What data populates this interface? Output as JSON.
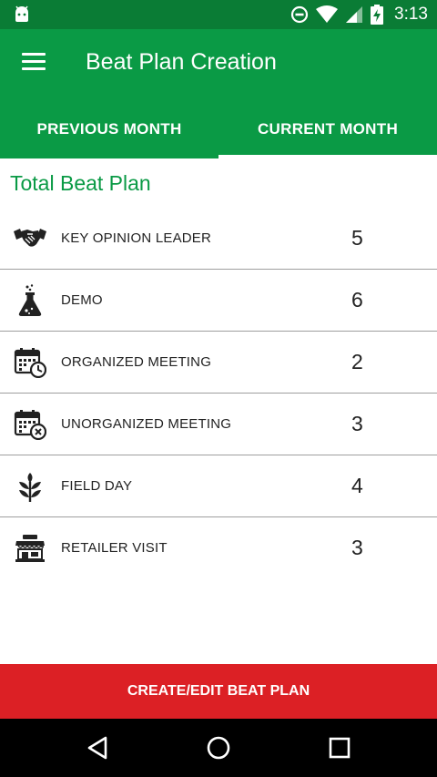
{
  "status_bar": {
    "time": "3:13",
    "icons": [
      "android-icon",
      "dnd-icon",
      "wifi-icon",
      "signal-icon",
      "battery-charging-icon"
    ]
  },
  "app_bar": {
    "menu_icon": "hamburger-menu-icon",
    "title": "Beat Plan Creation"
  },
  "tabs": [
    {
      "label": "PREVIOUS MONTH",
      "selected": false
    },
    {
      "label": "CURRENT MONTH",
      "selected": true
    }
  ],
  "section_title": "Total Beat Plan",
  "items": [
    {
      "label": "KEY OPINION LEADER",
      "count": "5",
      "icon": "handshake-icon"
    },
    {
      "label": "DEMO",
      "count": "6",
      "icon": "flask-icon"
    },
    {
      "label": "ORGANIZED MEETING",
      "count": "2",
      "icon": "calendar-clock-icon"
    },
    {
      "label": "UNORGANIZED MEETING",
      "count": "3",
      "icon": "calendar-cancel-icon"
    },
    {
      "label": "FIELD DAY",
      "count": "4",
      "icon": "plant-icon"
    },
    {
      "label": "RETAILER VISIT",
      "count": "3",
      "icon": "store-icon"
    }
  ],
  "cta": {
    "label": "CREATE/EDIT BEAT PLAN"
  },
  "nav": {
    "back_icon": "back-icon",
    "home_icon": "home-icon",
    "recents_icon": "recents-icon"
  },
  "colors": {
    "status_bar": "#0a7c35",
    "primary": "#0a9a45",
    "cta": "#dc2025"
  }
}
